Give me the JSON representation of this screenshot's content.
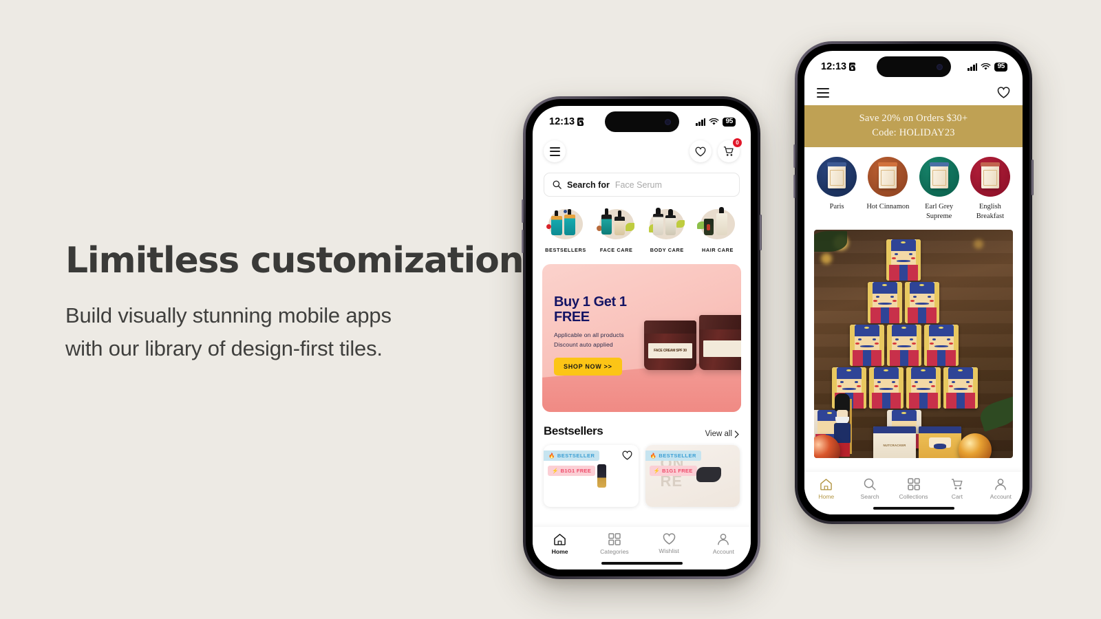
{
  "page": {
    "background_color": "#EDEAE4",
    "headline": "Limitless customization",
    "subcopy_line1": "Build visually stunning mobile apps",
    "subcopy_line2": "with our library of design-first tiles."
  },
  "phone1": {
    "status": {
      "time": "12:13",
      "battery": "95",
      "lock_icon": "lock-icon",
      "signal_icon": "cellular-signal-icon",
      "wifi_icon": "wifi-icon"
    },
    "header": {
      "menu_icon": "hamburger-menu-icon",
      "wishlist_icon": "heart-icon",
      "cart_icon": "shopping-cart-icon",
      "cart_count": "0"
    },
    "search": {
      "label": "Search for",
      "placeholder": "Face Serum",
      "icon": "search-icon"
    },
    "categories": [
      {
        "label": "BESTSELLERS"
      },
      {
        "label": "FACE CARE"
      },
      {
        "label": "BODY CARE"
      },
      {
        "label": "HAIR CARE"
      }
    ],
    "promo": {
      "title_line1": "Buy 1 Get 1",
      "title_line2": "FREE",
      "sub_line1": "Applicable on all products",
      "sub_line2": "Discount auto applied",
      "cta": "SHOP NOW >>",
      "product_label": "FACE CREAM SPF 30",
      "bg_color": "#F9C3BC",
      "title_color": "#141464",
      "cta_color": "#FCC516"
    },
    "section": {
      "title": "Bestsellers",
      "view_all": "View all",
      "chevron_icon": "chevron-right-icon"
    },
    "products": [
      {
        "bestseller_badge": "BESTSELLER",
        "offer_badge": "B1G1 FREE",
        "fire_icon": "fire-icon",
        "bolt_icon": "bolt-icon",
        "wishlist_icon": "heart-icon"
      },
      {
        "bestseller_badge": "BESTSELLER",
        "offer_badge": "B1G1 FREE",
        "fire_icon": "fire-icon",
        "bolt_icon": "bolt-icon"
      }
    ],
    "tabs": [
      {
        "label": "Home",
        "icon": "home-icon",
        "active": true
      },
      {
        "label": "Categories",
        "icon": "grid-icon",
        "active": false
      },
      {
        "label": "Wishlist",
        "icon": "heart-icon",
        "active": false
      },
      {
        "label": "Account",
        "icon": "person-icon",
        "active": false
      }
    ]
  },
  "phone2": {
    "status": {
      "time": "12:13",
      "battery": "95",
      "lock_icon": "lock-icon",
      "signal_icon": "cellular-signal-icon",
      "wifi_icon": "wifi-icon"
    },
    "header": {
      "menu_icon": "hamburger-menu-icon",
      "wishlist_icon": "heart-icon"
    },
    "promo_bar": {
      "line1": "Save 20% on Orders $30+",
      "line2": "Code: HOLIDAY23",
      "bg_color": "#BFA154"
    },
    "teas": [
      {
        "label": "Paris",
        "color": "#1E3668"
      },
      {
        "label": "Hot Cinnamon",
        "color": "#A8542A"
      },
      {
        "label": "Earl Grey Supreme",
        "color": "#0E7059"
      },
      {
        "label": "English Breakfast",
        "color": "#A4132E"
      }
    ],
    "hero": {
      "alt": "nutcracker-tin-pyramid-holiday-display"
    },
    "tabs": [
      {
        "label": "Home",
        "icon": "home-icon",
        "active": true
      },
      {
        "label": "Search",
        "icon": "search-icon",
        "active": false
      },
      {
        "label": "Collections",
        "icon": "grid-icon",
        "active": false
      },
      {
        "label": "Cart",
        "icon": "shopping-cart-icon",
        "active": false
      },
      {
        "label": "Account",
        "icon": "person-icon",
        "active": false
      }
    ],
    "accent_color": "#B39644"
  }
}
